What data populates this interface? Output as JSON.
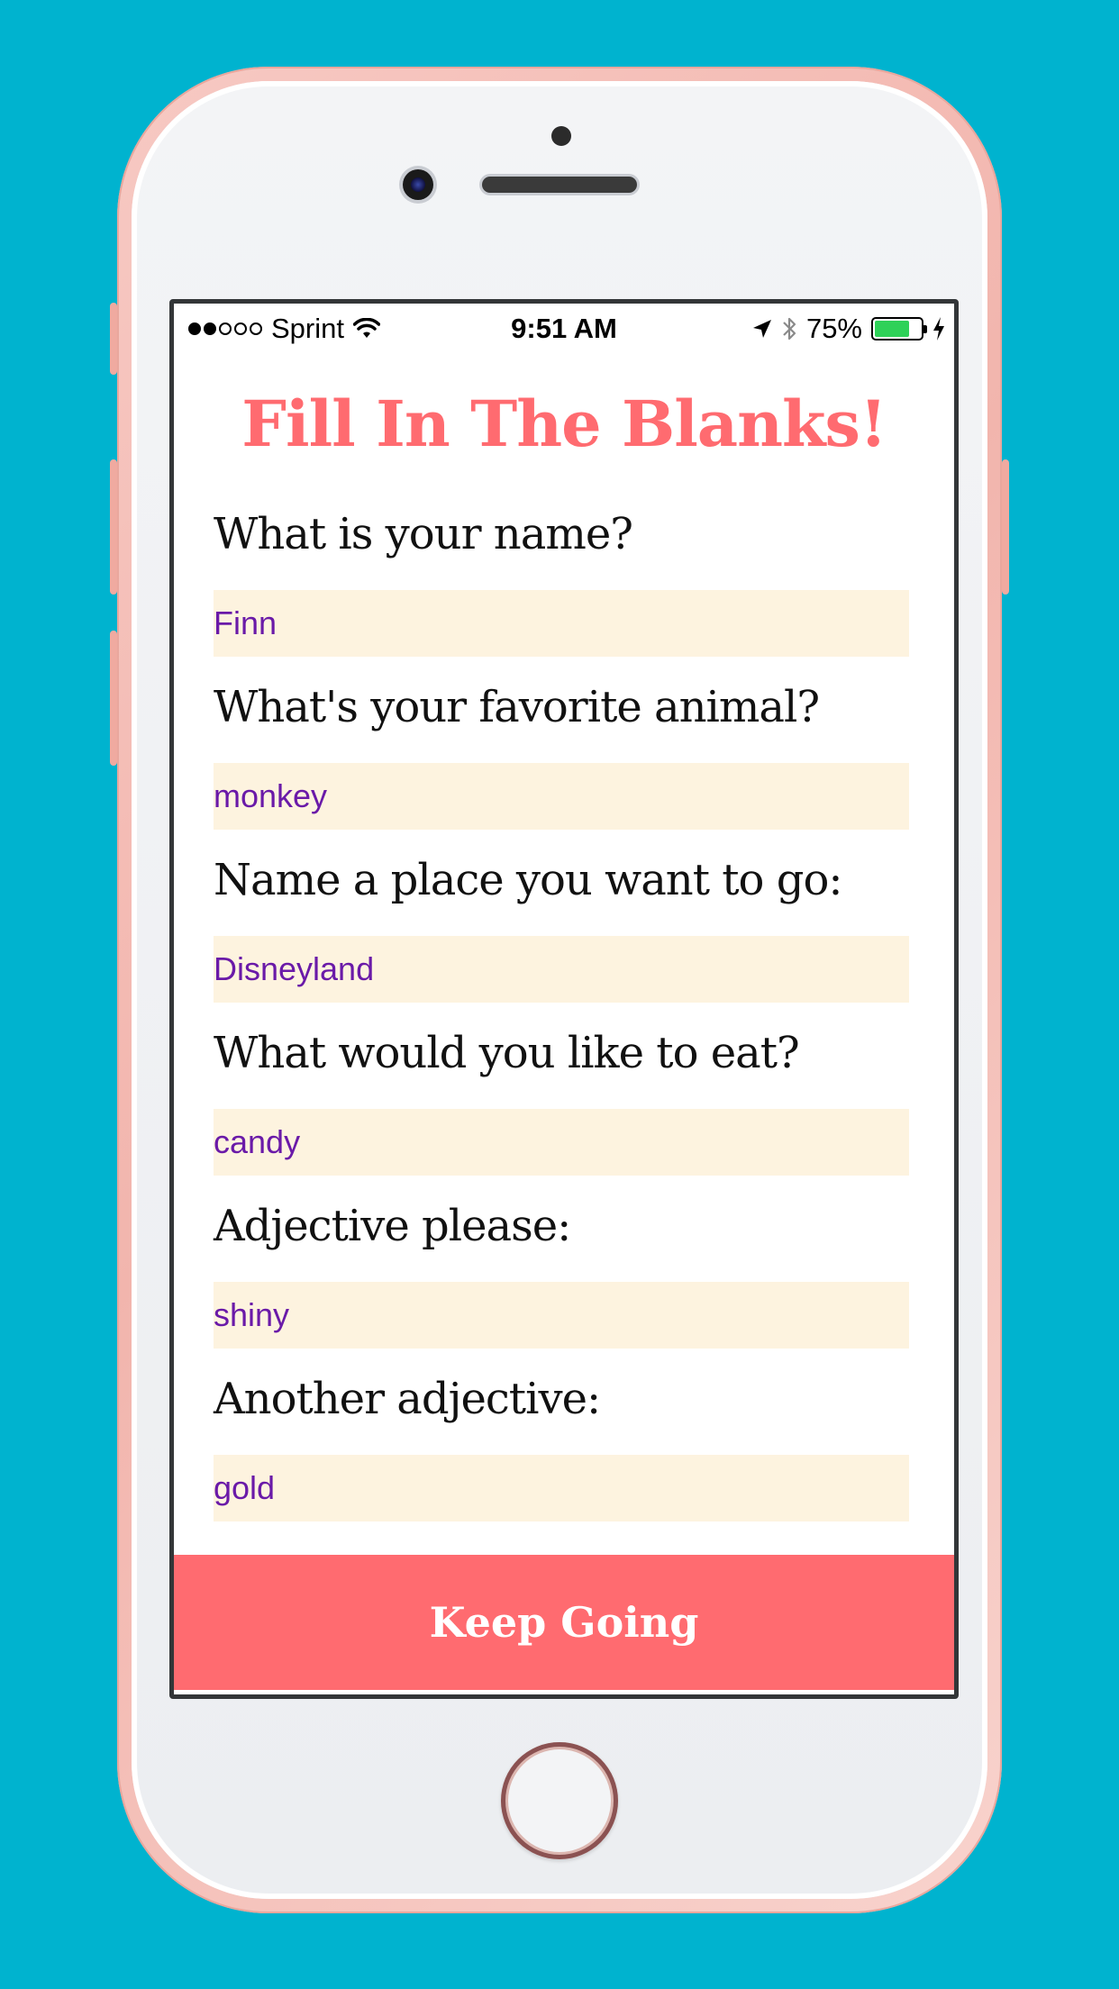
{
  "status_bar": {
    "carrier": "Sprint",
    "time": "9:51 AM",
    "battery_percent": "75%",
    "battery_level": 0.75,
    "signal_bars_filled": 2,
    "signal_bars_total": 5
  },
  "app": {
    "title": "Fill In The Blanks!",
    "submit_label": "Keep Going"
  },
  "fields": [
    {
      "question": "What is your name?",
      "answer": "Finn"
    },
    {
      "question": "What's your favorite animal?",
      "answer": "monkey"
    },
    {
      "question": "Name a place you want to go:",
      "answer": "Disneyland"
    },
    {
      "question": "What would you like to eat?",
      "answer": "candy"
    },
    {
      "question": "Adjective please:",
      "answer": "shiny"
    },
    {
      "question": "Another adjective:",
      "answer": "gold"
    }
  ],
  "colors": {
    "background": "#00b3cf",
    "accent": "#ff6b70",
    "answer_text": "#6a1aa8",
    "answer_field": "#fdf3df"
  }
}
